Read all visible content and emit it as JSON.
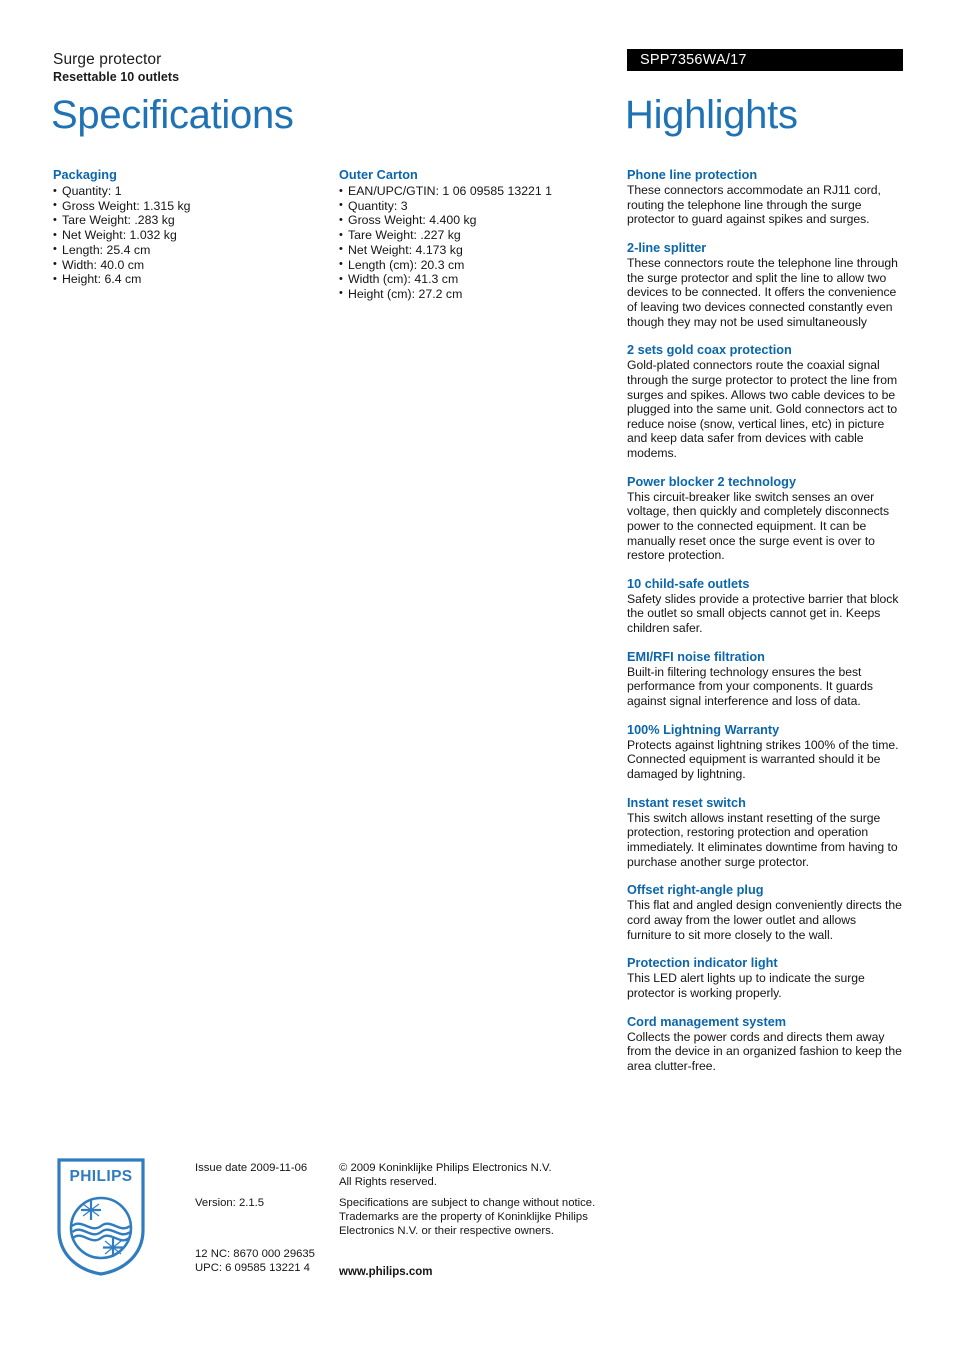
{
  "header": {
    "product_type": "Surge protector",
    "product_subtitle": "Resettable 10 outlets",
    "product_code": "SPP7356WA/17",
    "code_bar_color": "#000000"
  },
  "titles": {
    "specifications": "Specifications",
    "highlights": "Highlights",
    "title_color": "#1f72b4",
    "subheading_color": "#0b66ab"
  },
  "specifications": {
    "columns": [
      {
        "group_title": "Packaging",
        "items": [
          "Quantity: 1",
          "Gross Weight: 1.315 kg",
          "Tare Weight: .283 kg",
          "Net Weight: 1.032 kg",
          "Length: 25.4 cm",
          "Width: 40.0 cm",
          "Height: 6.4 cm"
        ]
      },
      {
        "group_title": "Outer Carton",
        "items": [
          "EAN/UPC/GTIN: 1 06 09585 13221 1",
          "Quantity: 3",
          "Gross Weight: 4.400 kg",
          "Tare Weight: .227 kg",
          "Net Weight: 4.173 kg",
          "Length (cm): 20.3 cm",
          "Width (cm): 41.3 cm",
          "Height (cm): 27.2 cm"
        ]
      }
    ]
  },
  "highlights": {
    "blocks": [
      {
        "title": "Phone line protection",
        "body": "These connectors accommodate an RJ11 cord, routing the telephone line through the surge protector to guard against spikes and surges."
      },
      {
        "title": "2-line splitter",
        "body": "These connectors route the telephone line through the surge protector and split the line to allow two devices to be connected. It offers the convenience of leaving two devices connected constantly even though they may not be used simultaneously"
      },
      {
        "title": "2 sets gold coax protection",
        "body": "Gold-plated connectors route the coaxial signal through the surge protector to protect the line from surges and spikes. Allows two cable devices to be plugged into the same unit. Gold connectors act to reduce noise (snow, vertical lines, etc) in picture and keep data safer from devices with cable modems."
      },
      {
        "title": "Power blocker 2 technology",
        "body": "This circuit-breaker like switch senses an over voltage, then quickly and completely disconnects power to the connected equipment. It can be manually reset once the surge event is over to restore protection."
      },
      {
        "title": "10 child-safe outlets",
        "body": "Safety slides provide a protective barrier that block the outlet so small objects cannot get in. Keeps children safer."
      },
      {
        "title": "EMI/RFI noise filtration",
        "body": "Built-in filtering technology ensures the best performance from your components. It guards against signal interference and loss of data."
      },
      {
        "title": "100% Lightning Warranty",
        "body": "Protects against lightning strikes 100% of the time. Connected equipment is warranted should it be damaged by lightning."
      },
      {
        "title": "Instant reset switch",
        "body": "This switch allows instant resetting of the surge protection, restoring protection and operation immediately. It eliminates downtime from having to purchase another surge protector."
      },
      {
        "title": "Offset right-angle plug",
        "body": "This flat and angled design conveniently directs the cord away from the lower outlet and allows furniture to sit more closely to the wall."
      },
      {
        "title": "Protection indicator light",
        "body": "This LED alert lights up to indicate the surge protector is working properly."
      },
      {
        "title": "Cord management system",
        "body": "Collects the power cords and directs them away from the device in an organized fashion to keep the area clutter-free."
      }
    ]
  },
  "footer": {
    "logo_wordmark": "PHILIPS",
    "logo_color": "#2f7cc0",
    "issue_date": "Issue date 2009-11-06",
    "version": "Version: 2.1.5",
    "twelve_nc": "12 NC: 8670 000 29635",
    "upc": "UPC: 6 09585 13221 4",
    "copyright_line1": "© 2009 Koninklijke Philips Electronics N.V.",
    "copyright_line2": "All Rights reserved.",
    "disclaimer": "Specifications are subject to change without notice. Trademarks are the property of Koninklijke Philips Electronics N.V. or their respective owners.",
    "website": "www.philips.com"
  }
}
